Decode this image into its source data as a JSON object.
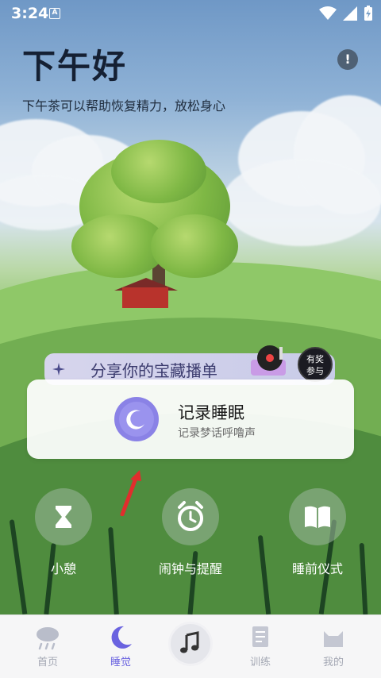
{
  "status_bar": {
    "time": "3:24",
    "notification_badge": "A"
  },
  "header": {
    "greeting": "下午好",
    "subtitle": "下午茶可以帮助恢复精力，放松身心",
    "info_icon": "exclamation-icon"
  },
  "banner": {
    "title": "分享你的宝藏播单",
    "prize_badge_line1": "有奖",
    "prize_badge_line2": "参与"
  },
  "record_card": {
    "title": "记录睡眠",
    "subtitle": "记录梦话呼噜声",
    "icon": "moon-icon",
    "accent": "#8a82e6"
  },
  "quick_actions": [
    {
      "label": "小憩",
      "icon": "hourglass-icon"
    },
    {
      "label": "闹钟与提醒",
      "icon": "alarm-clock-icon"
    },
    {
      "label": "睡前仪式",
      "icon": "book-icon"
    }
  ],
  "tabbar": {
    "tabs": [
      {
        "label": "首页",
        "icon": "cloud-rain-icon",
        "active": false
      },
      {
        "label": "睡觉",
        "icon": "moon-icon",
        "active": true
      },
      {
        "label": "",
        "icon": "music-note-icon",
        "active": false
      },
      {
        "label": "训练",
        "icon": "notebook-icon",
        "active": false
      },
      {
        "label": "我的",
        "icon": "cat-face-icon",
        "active": false
      }
    ],
    "active_color": "#6a63e0",
    "inactive_color": "#a4a8b4"
  }
}
